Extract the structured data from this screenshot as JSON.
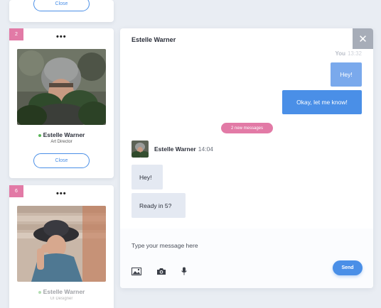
{
  "cards": [
    {
      "close_label": "Close"
    },
    {
      "badge": "2",
      "menu": "•••",
      "name": "Estelle Warner",
      "role": "Art Director",
      "close_label": "Close"
    },
    {
      "badge": "6",
      "menu": "•••",
      "name": "Estelle Warner",
      "role": "UI Designer"
    }
  ],
  "chat": {
    "title": "Estelle Warner",
    "close_glyph": "✕",
    "you_label": "You",
    "you_time": "13:32",
    "outgoing": [
      "Hey!",
      "Okay, let me know!"
    ],
    "new_messages": "2 new messages",
    "sender_name": "Estelle Warner",
    "sender_time": "14:04",
    "incoming": [
      "Hey!",
      "Ready in 5?"
    ],
    "input_placeholder": "Type your message here",
    "tools": [
      "image-icon",
      "camera-icon",
      "microphone-icon"
    ],
    "send_label": "Send"
  },
  "colors": {
    "accent": "#4a8fe7",
    "pink": "#e27aa6",
    "online": "#58b557",
    "incoming_bubble": "#e4e9f2"
  }
}
